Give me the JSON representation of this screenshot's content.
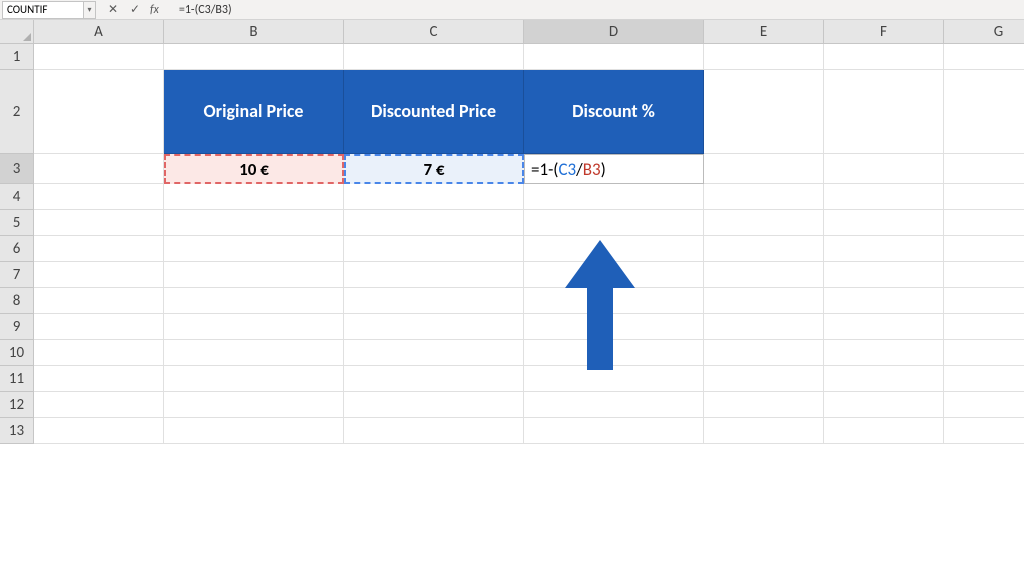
{
  "formula_bar": {
    "name_box": "COUNTIF",
    "formula": "=1-(C3/B3)",
    "cancel_icon": "✕",
    "enter_icon": "✓",
    "fx_label": "fx"
  },
  "columns": [
    "A",
    "B",
    "C",
    "D",
    "E",
    "F",
    "G"
  ],
  "rows": [
    "1",
    "2",
    "3",
    "4",
    "5",
    "6",
    "7",
    "8",
    "9",
    "10",
    "11",
    "12",
    "13"
  ],
  "headers": {
    "b2": "Original Price",
    "c2": "Discounted Price",
    "d2": "Discount %"
  },
  "data": {
    "b3": "10 €",
    "c3": "7 €",
    "d3_prefix": "=1-(",
    "d3_c3": "C3",
    "d3_slash": "/",
    "d3_b3": "B3",
    "d3_suffix": ")"
  },
  "colors": {
    "header_bg": "#1f5fb8",
    "b3_bg": "#fce8e6",
    "c3_bg": "#eaf1fa",
    "arrow": "#1f5fb8"
  }
}
